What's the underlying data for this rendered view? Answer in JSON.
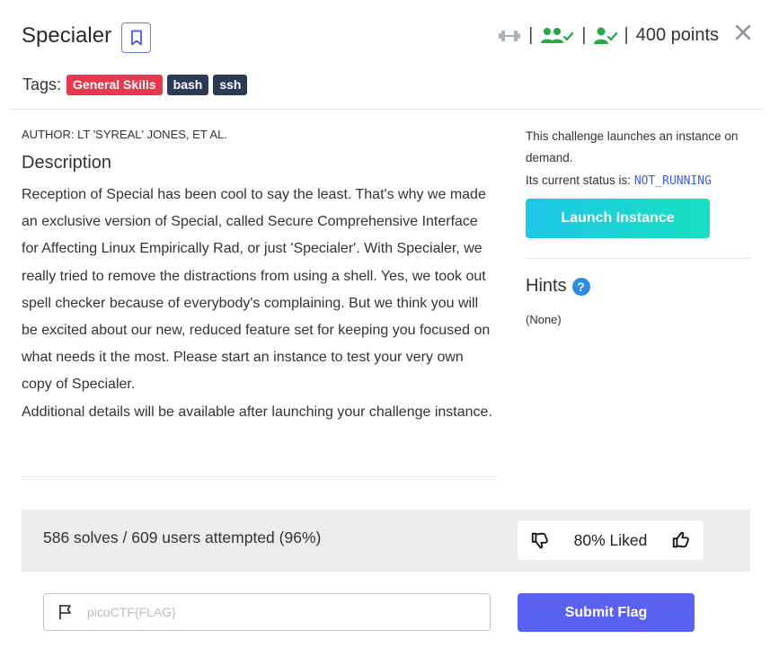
{
  "challenge": {
    "title": "Specialer",
    "points": "400 points",
    "separator": "|",
    "close_icon": "close-icon",
    "bookmark_icon": "bookmark-icon",
    "meta_icons": [
      "dumbbell-icon",
      "users-check-icon",
      "user-check-icon"
    ]
  },
  "tags": {
    "label": "Tags:",
    "items": [
      {
        "text": "General Skills",
        "color": "#e8384f"
      },
      {
        "text": "bash",
        "color": "#2d3a55"
      },
      {
        "text": "ssh",
        "color": "#2d3a55"
      }
    ]
  },
  "main": {
    "author": "AUTHOR: LT 'SYREAL' JONES, ET AL.",
    "description_title": "Description",
    "description": "Reception of Special has been cool to say the least. That's why we made an exclusive version of Special, called Secure Comprehensive Interface for Affecting Linux Empirically Rad, or just 'Specialer'. With Specialer, we really tried to remove the distractions from using a shell. Yes, we took out spell checker because of everybody's complaining. But we think you will be excited about our new, reduced feature set for keeping you focused on what needs it the most. Please start an instance to test your very own copy of Specialer.",
    "additional": "Additional details will be available after launching your challenge instance."
  },
  "sidebar": {
    "launch_note": "This challenge launches an instance on demand.",
    "status_label": "Its current status is:",
    "status_value": "NOT_RUNNING",
    "launch_button": "Launch Instance",
    "hints_title": "Hints",
    "help_glyph": "?",
    "hints_value": "(None)"
  },
  "stats": {
    "solves_text": "586 solves / 609 users attempted (96%)",
    "liked_text": "80% Liked"
  },
  "flag": {
    "placeholder": "picoCTF{FLAG}",
    "submit_label": "Submit Flag"
  },
  "colors": {
    "accent": "#5a61f2",
    "tag_red": "#e8384f",
    "tag_dark": "#2d3a55",
    "success_green": "#28a745",
    "status_blue": "#3b5fd9"
  }
}
